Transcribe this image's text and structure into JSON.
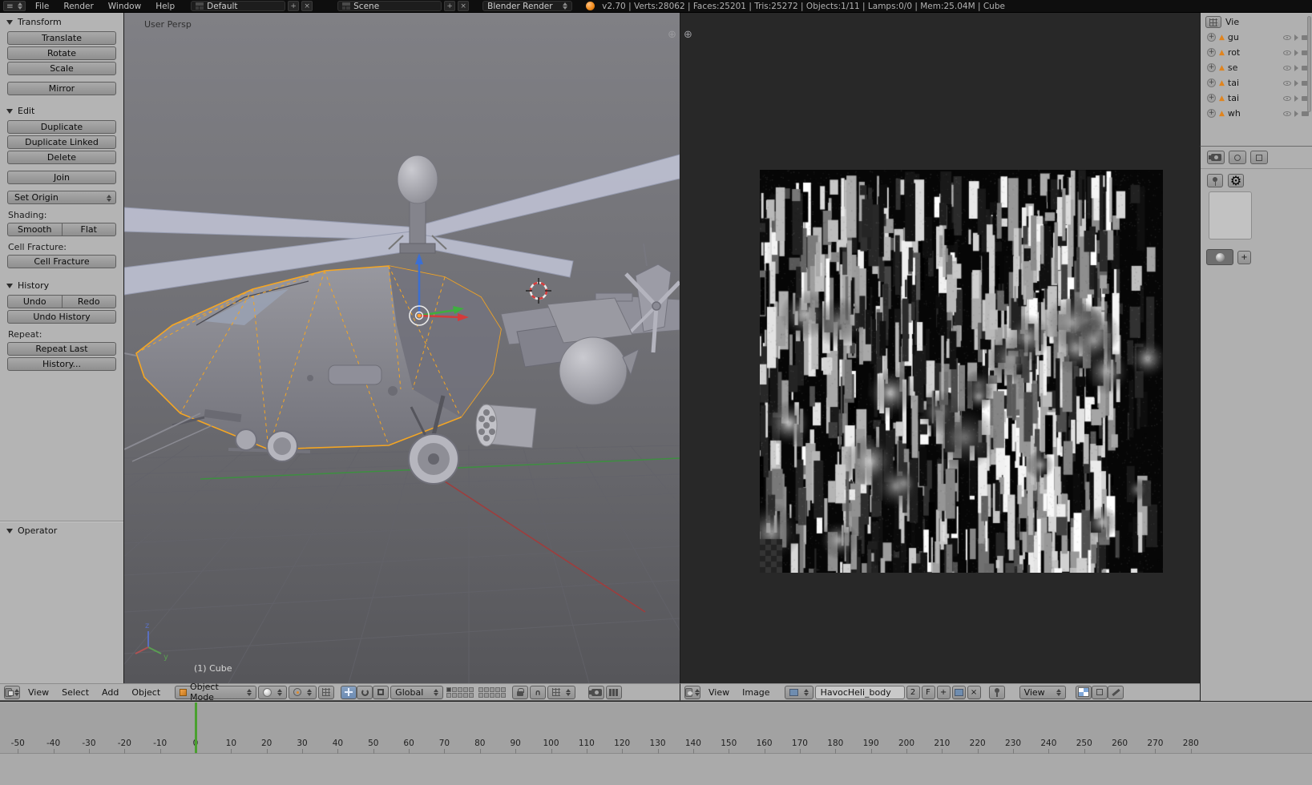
{
  "colors": {
    "accent_orange": "#ff9d2e",
    "selection_outline": "#f5a623",
    "playhead_green": "#4aa02f",
    "axis_x_red": "#d43b3b",
    "axis_y_green": "#3fae3f",
    "axis_z_blue": "#3b6fd4"
  },
  "icons": {
    "menu_lines": "≡",
    "plus": "+",
    "close": "×",
    "corner_plus": "⊕",
    "mesh_triangle": "▲",
    "expand": "+",
    "magnet": "∪",
    "gear": "⚙"
  },
  "topbar": {
    "menus": [
      "File",
      "Render",
      "Window",
      "Help"
    ],
    "layout_selector": {
      "value": "Default"
    },
    "scene_selector": {
      "value": "Scene"
    },
    "engine_selector": {
      "value": "Blender Render"
    },
    "stats": "v2.70 | Verts:28062 | Faces:25201 | Tris:25272 | Objects:1/11 | Lamps:0/0 | Mem:25.04M | Cube"
  },
  "tool_shelf": {
    "transform_panel": {
      "title": "Transform",
      "translate": "Translate",
      "rotate": "Rotate",
      "scale": "Scale",
      "mirror": "Mirror"
    },
    "edit_panel": {
      "title": "Edit",
      "duplicate": "Duplicate",
      "duplicate_linked": "Duplicate Linked",
      "delete": "Delete",
      "join": "Join",
      "set_origin": "Set Origin",
      "shading_label": "Shading:",
      "smooth": "Smooth",
      "flat": "Flat",
      "cell_fracture_label": "Cell Fracture:",
      "cell_fracture": "Cell Fracture"
    },
    "history_panel": {
      "title": "History",
      "undo": "Undo",
      "redo": "Redo",
      "undo_history": "Undo History",
      "repeat_label": "Repeat:",
      "repeat_last": "Repeat Last",
      "history": "History..."
    },
    "operator_panel": {
      "title": "Operator"
    }
  },
  "viewport": {
    "view_name": "User Persp",
    "active_object": "(1) Cube",
    "axis_z": "z",
    "axis_y": "y",
    "header": {
      "menus": [
        "View",
        "Select",
        "Add",
        "Object"
      ],
      "mode": "Object Mode",
      "orientation": "Global"
    }
  },
  "uv_editor": {
    "header": {
      "menus": [
        "View",
        "Image"
      ],
      "image_name": "HavocHeli_body",
      "users_count": "2",
      "fake_user": "F",
      "mode": "View"
    }
  },
  "outliner": {
    "top_label": "Vie",
    "items": [
      {
        "label": "gu"
      },
      {
        "label": "rot"
      },
      {
        "label": "se"
      },
      {
        "label": "tai"
      },
      {
        "label": "tai"
      },
      {
        "label": "wh"
      }
    ]
  },
  "timeline": {
    "frame_labels": [
      "-50",
      "-40",
      "-30",
      "-20",
      "-10",
      "0",
      "10",
      "20",
      "30",
      "40",
      "50",
      "60",
      "70",
      "80",
      "90",
      "100",
      "110",
      "120",
      "130",
      "140",
      "150",
      "160",
      "170",
      "180",
      "190",
      "200",
      "210",
      "220",
      "230",
      "240",
      "250",
      "260",
      "270",
      "280"
    ],
    "current_frame_label": "0"
  }
}
